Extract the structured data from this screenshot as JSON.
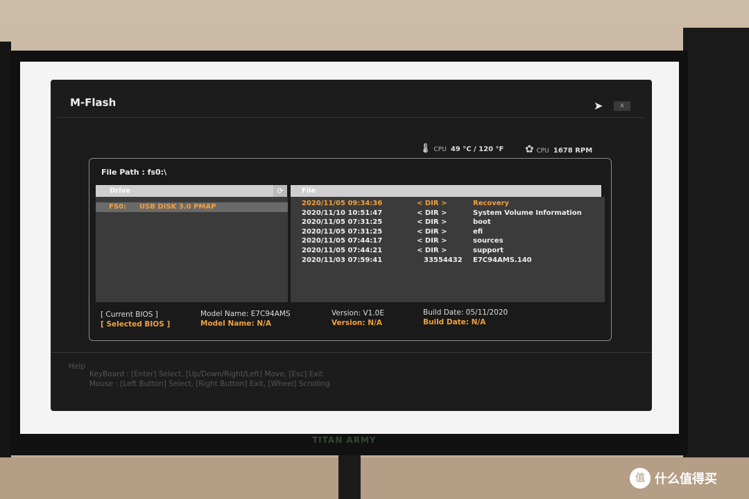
{
  "window": {
    "title": "M-Flash",
    "close_label": "x"
  },
  "hardware": {
    "cpu_temp_label": "CPU",
    "cpu_temp_value": "49 °C / 120 °F",
    "cpu_fan_label": "CPU",
    "cpu_fan_value": "1678 RPM",
    "icons": [
      "thermometer-icon",
      "fan-icon"
    ]
  },
  "file_path": "File Path : fs0:\\",
  "drive_panel": {
    "header": "Drive",
    "items": [
      {
        "id": "FS0:",
        "name": "USB DISK 3.0 PMAP",
        "selected": true
      }
    ]
  },
  "file_panel": {
    "header": "File",
    "rows": [
      {
        "date": "2020/11/05 09:34:36",
        "type": "< DIR >",
        "name": "Recovery",
        "selected": true
      },
      {
        "date": "2020/11/10 10:51:47",
        "type": "< DIR >",
        "name": "System Volume Information"
      },
      {
        "date": "2020/11/05 07:31:25",
        "type": "< DIR >",
        "name": "boot"
      },
      {
        "date": "2020/11/05 07:31:25",
        "type": "< DIR >",
        "name": "efi"
      },
      {
        "date": "2020/11/05 07:44:17",
        "type": "< DIR >",
        "name": "sources"
      },
      {
        "date": "2020/11/05 07:44:21",
        "type": "< DIR >",
        "name": "support"
      },
      {
        "date": "2020/11/03 07:59:41",
        "type": "33554432",
        "name": "E7C94AMS.140"
      }
    ]
  },
  "bios_info": {
    "current": {
      "label": "[ Current BIOS ]",
      "model": "Model Name: E7C94AMS",
      "version": "Version: V1.0E",
      "build": "Build Date: 05/11/2020"
    },
    "selected": {
      "label": "[ Selected BIOS ]",
      "model": "Model Name: N/A",
      "version": "Version: N/A",
      "build": "Build Date: N/A"
    }
  },
  "help": {
    "title": "Help",
    "keyboard": "KeyBoard :  [Enter]  Select,   [Up/Down/Right/Left]  Move,   [Esc]  Exit",
    "mouse": "Mouse     :  [Left Button]  Select,   [Right Button]  Exit,   [Wheel]  Scrolling"
  },
  "monitor_brand": "TITAN ARMY",
  "watermark": {
    "symbol": "值",
    "text": "什么值得买"
  },
  "colors": {
    "accent": "#f0a040",
    "background": "#1d1c1c",
    "list_bg": "#3b3b3b"
  }
}
